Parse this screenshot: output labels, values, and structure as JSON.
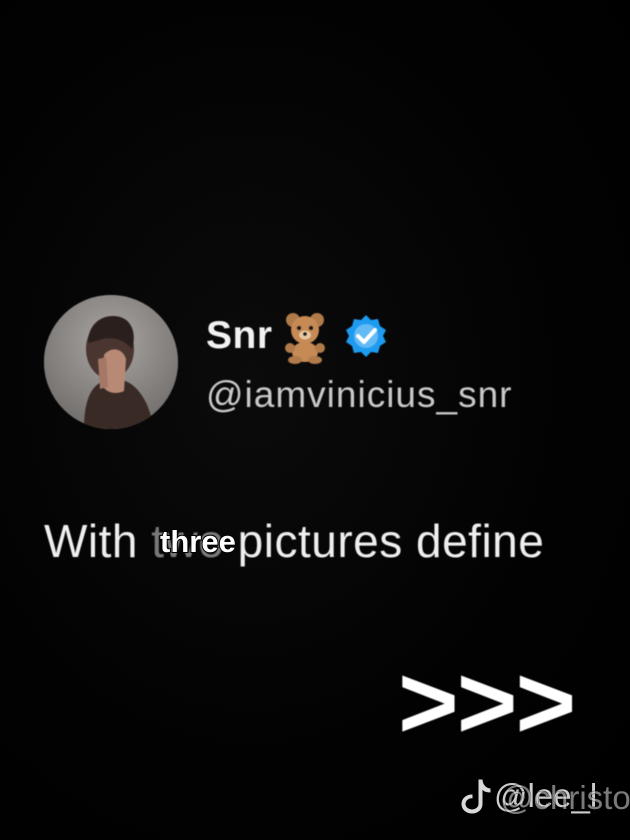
{
  "tweet": {
    "display_name": "Snr",
    "name_emoji": "teddy-bear",
    "verified_icon": "verified-badge-icon",
    "handle": "@iamvinicius_snr",
    "text_start": "With ",
    "text_covered": "two",
    "text_end": " pictures define"
  },
  "caption_overlay": "three",
  "arrows": ">>>",
  "watermark": {
    "icon": "tiktok-icon",
    "text": "@lee_l",
    "text_overlap": "@christopl"
  },
  "colors": {
    "background": "#000000",
    "verified_blue": "#1d9bf0",
    "name_text": "#f2f2f2",
    "handle_text": "#c9c9c9"
  }
}
